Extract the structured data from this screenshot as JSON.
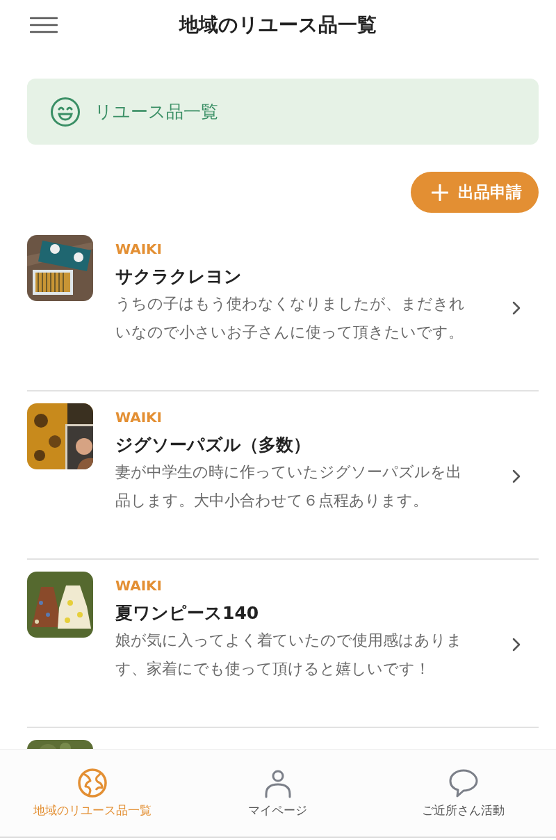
{
  "header": {
    "title": "地域のリユース品一覧"
  },
  "banner": {
    "label": "リユース品一覧"
  },
  "action_button": {
    "label": "出品申請"
  },
  "items": [
    {
      "thumbnail": {
        "kind": "picture"
      },
      "source": "WAIKI",
      "title": "サクラクレヨン",
      "description": "うちの子はもう使わなくなりましたが、まだきれいなので小さいお子さんに使って頂きたいです。"
    },
    {
      "thumbnail": {
        "kind": "picture"
      },
      "source": "WAIKI",
      "title": "ジグソーパズル（多数）",
      "description": "妻が中学生の時に作っていたジグソーパズルを出品します。大中小合わせて６点程あります。"
    },
    {
      "thumbnail": {
        "kind": "picture"
      },
      "source": "WAIKI",
      "title": "夏ワンピース140",
      "description": "娘が気に入ってよく着ていたので使用感はあります、家着にでも使って頂けると嬉しいです！"
    },
    {
      "thumbnail": {
        "kind": "picture"
      }
    }
  ],
  "bottom_nav": [
    {
      "label": "地域のリユース品一覧",
      "selected": true
    },
    {
      "label": "マイページ",
      "selected": false
    },
    {
      "label": "ご近所さん活動",
      "selected": false
    }
  ]
}
